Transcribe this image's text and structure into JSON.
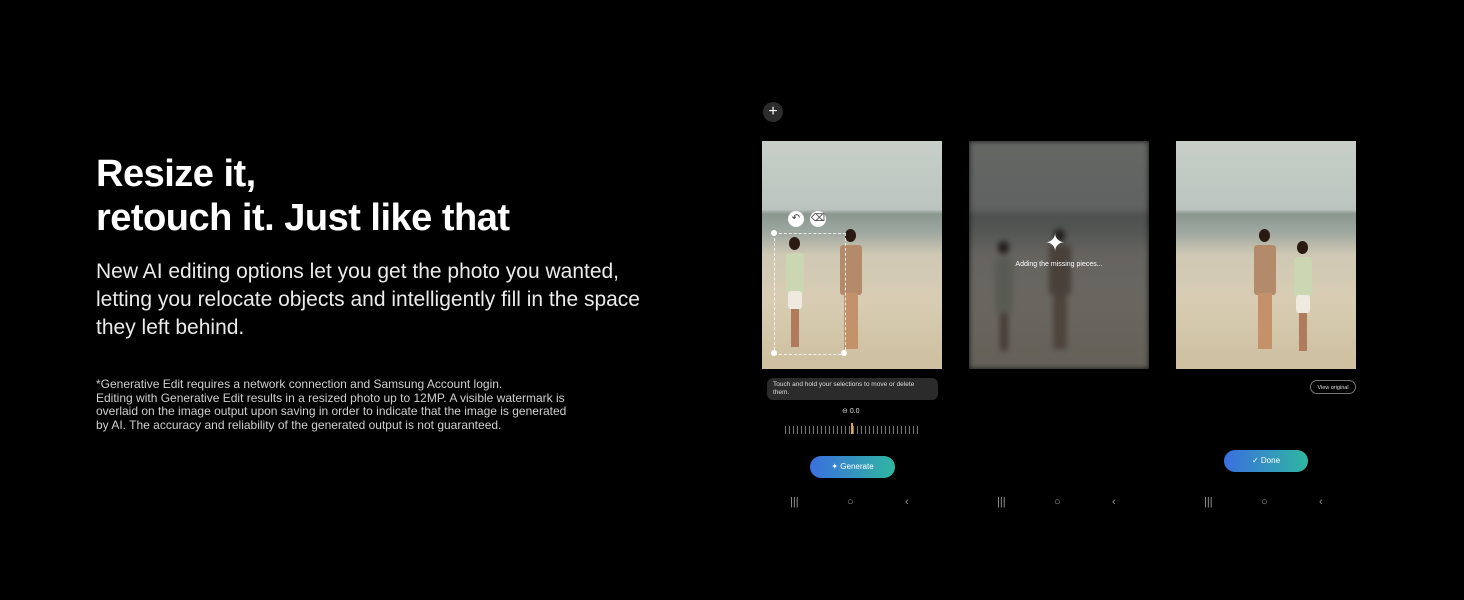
{
  "headline": {
    "line1": "Resize it,",
    "line2": "retouch it. Just like that"
  },
  "body": "New AI editing options let you get the photo you wanted, letting you relocate objects and intelligently fill in the space they left behind.",
  "disclaimer": {
    "line1": "*Generative Edit requires a network connection and Samsung Account login.",
    "line2": "Editing with Generative Edit results in a resized photo up to 12MP. A visible watermark is",
    "line3": "overlaid on the image output upon saving in order to indicate that the image is generated",
    "line4": "by AI. The accuracy and reliability of the generated output is not guaranteed."
  },
  "screen1": {
    "add_icon": "plus-icon",
    "hint": "Touch and hold your selections to move or delete them.",
    "angle_value": "0.0",
    "generate_label": "Generate",
    "nav_icons": [
      "recents-icon",
      "home-icon",
      "back-icon"
    ]
  },
  "screen2": {
    "status": "Adding the missing pieces..."
  },
  "screen3": {
    "view_original_label": "View original",
    "done_label": "Done"
  },
  "colors": {
    "accent_start": "#3a6fe0",
    "accent_end": "#2fb6a0",
    "ruler_marker": "#e5a823"
  }
}
